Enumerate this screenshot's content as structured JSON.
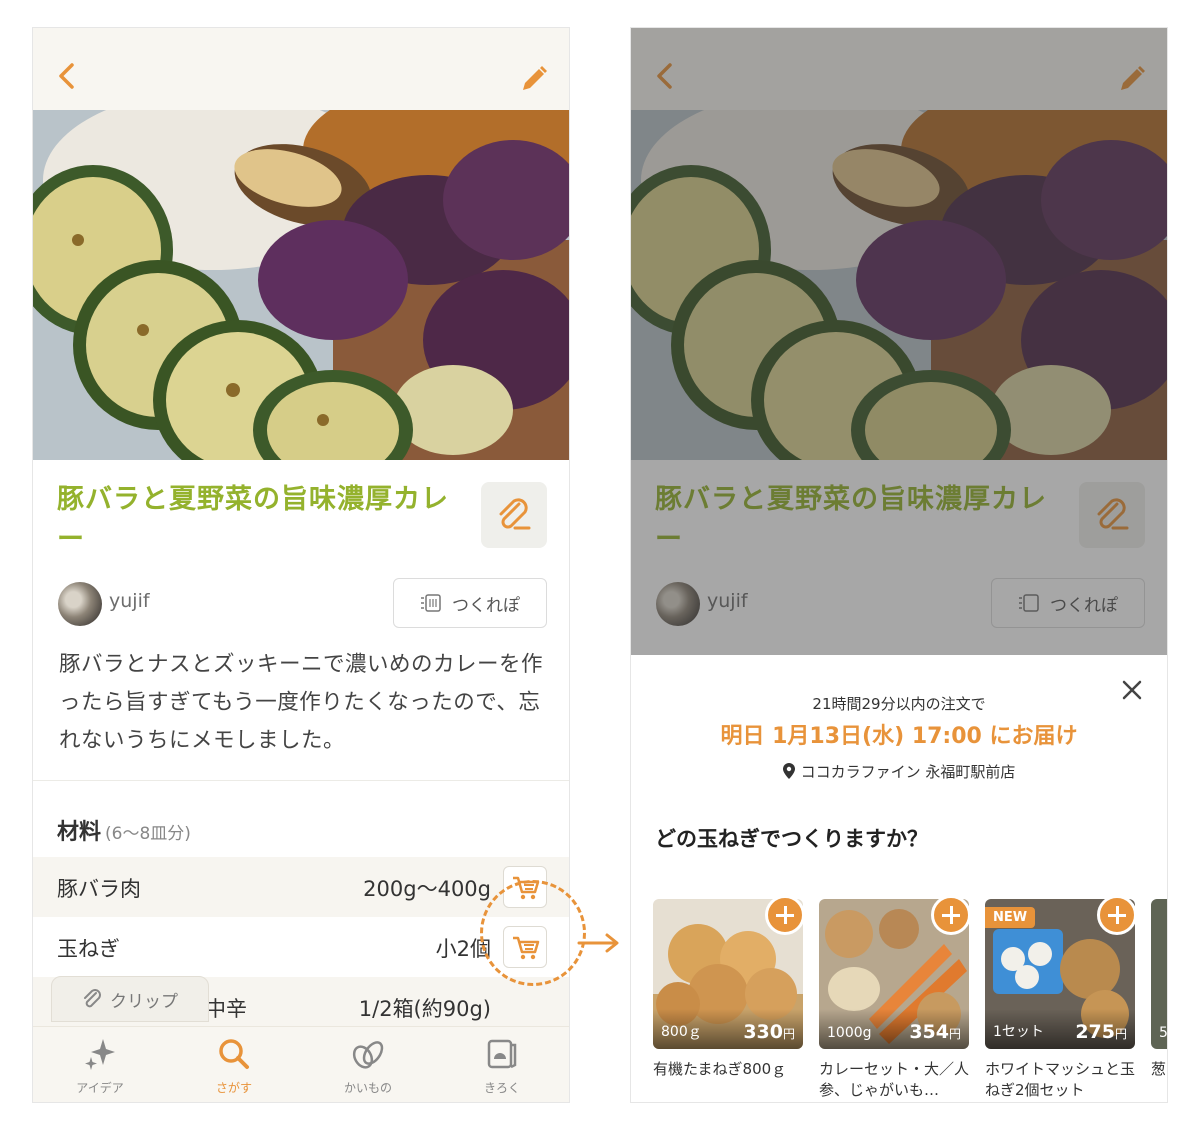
{
  "recipe": {
    "title": "豚バラと夏野菜の旨味濃厚カレー",
    "author": "yujif",
    "tsukurepo_label": "つくれぽ",
    "description": "豚バラとナスとズッキーニで濃いめのカレーを作ったら旨すぎてもう一度作りたくなったので、忘れないうちにメモしました。",
    "ingredients_label": "材料",
    "servings": "(6〜8皿分)",
    "ingredients": [
      {
        "name": "豚バラ肉",
        "amount": "200g〜400g"
      },
      {
        "name": "玉ねぎ",
        "amount": "小2個"
      },
      {
        "name": "中辛",
        "amount": "1/2箱(約90g)"
      }
    ],
    "clip_label": "クリップ"
  },
  "tabs": [
    {
      "label": "アイデア",
      "icon": "sparkle-icon"
    },
    {
      "label": "さがす",
      "icon": "search-icon"
    },
    {
      "label": "かいもの",
      "icon": "shopping-icon"
    },
    {
      "label": "きろく",
      "icon": "record-icon"
    }
  ],
  "sheet": {
    "order_deadline": "21時間29分以内の注文で",
    "delivery": "明日 1月13日(水) 17:00 にお届け",
    "store": "ココカラファイン 永福町駅前店",
    "question": "どの玉ねぎでつくりますか？",
    "products": [
      {
        "name": "有機たまねぎ800ｇ",
        "weight": "800ｇ",
        "price": "330",
        "unit": "円",
        "is_new": false
      },
      {
        "name": "カレーセット・大／人参、じゃがいも…",
        "weight": "1000g",
        "price": "354",
        "unit": "円",
        "is_new": false
      },
      {
        "name": "ホワイトマッシュと玉ねぎ2個セット",
        "weight": "1セット",
        "price": "275",
        "unit": "円",
        "is_new": true,
        "badge": "NEW"
      },
      {
        "name": "葱ニ",
        "weight": "5",
        "price": "",
        "unit": "",
        "is_new": false
      }
    ]
  },
  "colors": {
    "accent": "#e8933a",
    "title_green": "#94b22d",
    "bar_bg": "#f8f6f1"
  }
}
